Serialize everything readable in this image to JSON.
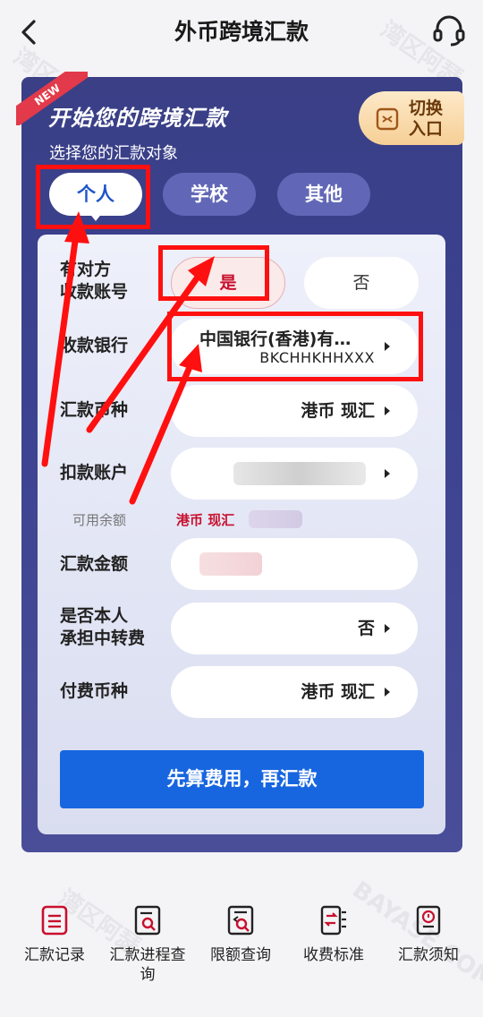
{
  "header": {
    "title": "外币跨境汇款"
  },
  "hero": {
    "ribbon": "NEW",
    "title": "开始您的跨境汇款",
    "subtitle": "选择您的汇款对象",
    "switch_label_line1": "切换",
    "switch_label_line2": "入口"
  },
  "tabs": [
    {
      "label": "个人",
      "selected": true
    },
    {
      "label": "学校",
      "selected": false
    },
    {
      "label": "其他",
      "selected": false
    }
  ],
  "form": {
    "has_account_label_1": "有对方",
    "has_account_label_2": "收款账号",
    "yes": "是",
    "no": "否",
    "bank_label": "收款银行",
    "bank_name": "中国银行(香港)有…",
    "bank_code": "BKCHHKHHXXX",
    "currency_label": "汇款币种",
    "currency_value": "港币 现汇",
    "debit_label": "扣款账户",
    "available_label": "可用余额",
    "available_currency": "港币 现汇",
    "amount_label": "汇款金额",
    "fee_bearer_label_1": "是否本人",
    "fee_bearer_label_2": "承担中转费",
    "fee_bearer_value": "否",
    "fee_currency_label": "付费币种",
    "fee_currency_value": "港币 现汇",
    "submit": "先算费用，再汇款"
  },
  "bottom_nav": [
    {
      "label": "汇款记录",
      "icon": "list-doc-icon"
    },
    {
      "label": "汇款进程查询",
      "icon": "search-doc-icon"
    },
    {
      "label": "限额查询",
      "icon": "limit-search-icon"
    },
    {
      "label": "收费标准",
      "icon": "fee-standard-icon"
    },
    {
      "label": "汇款须知",
      "icon": "notice-icon"
    }
  ],
  "watermark": {
    "cn": "湾区阿瑟",
    "en": "BAYASE.COM"
  },
  "colors": {
    "primary": "#1766e0",
    "card": "#3a3f86",
    "accent_red": "#c8102e",
    "annotation": "#ff1010"
  }
}
